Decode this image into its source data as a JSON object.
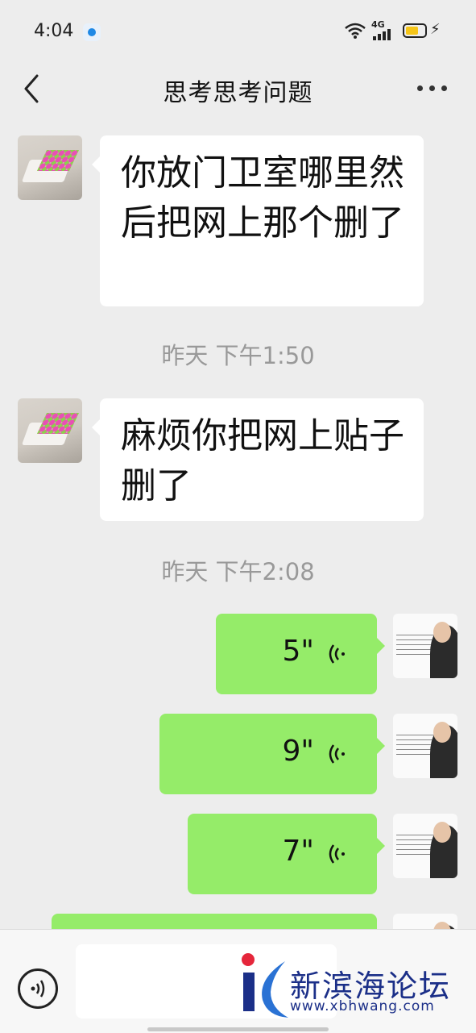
{
  "status_bar": {
    "time": "4:04",
    "network": "4G"
  },
  "header": {
    "title": "思考思考问题"
  },
  "messages": [
    {
      "side": "left",
      "type": "text",
      "text": "你放门卫室哪里然后把网上那个删了"
    },
    {
      "type": "timestamp",
      "text": "昨天 下午1:50"
    },
    {
      "side": "left",
      "type": "text",
      "text": "麻烦你把网上贴子删了"
    },
    {
      "type": "timestamp",
      "text": "昨天 下午2:08"
    },
    {
      "side": "right",
      "type": "voice",
      "duration": "5\""
    },
    {
      "side": "right",
      "type": "voice",
      "duration": "9\""
    },
    {
      "side": "right",
      "type": "voice",
      "duration": "7\""
    },
    {
      "side": "right",
      "type": "voice",
      "duration": ""
    }
  ],
  "watermark": {
    "name": "新滨海论坛",
    "url": "www.xbhwang.com"
  },
  "colors": {
    "background": "#ededed",
    "sent_bubble": "#95ec69",
    "received_bubble": "#ffffff"
  },
  "icons": [
    "back-icon",
    "more-icon",
    "voice-wave-icon",
    "voice-input-icon",
    "wifi-icon",
    "signal-icon",
    "battery-icon"
  ]
}
